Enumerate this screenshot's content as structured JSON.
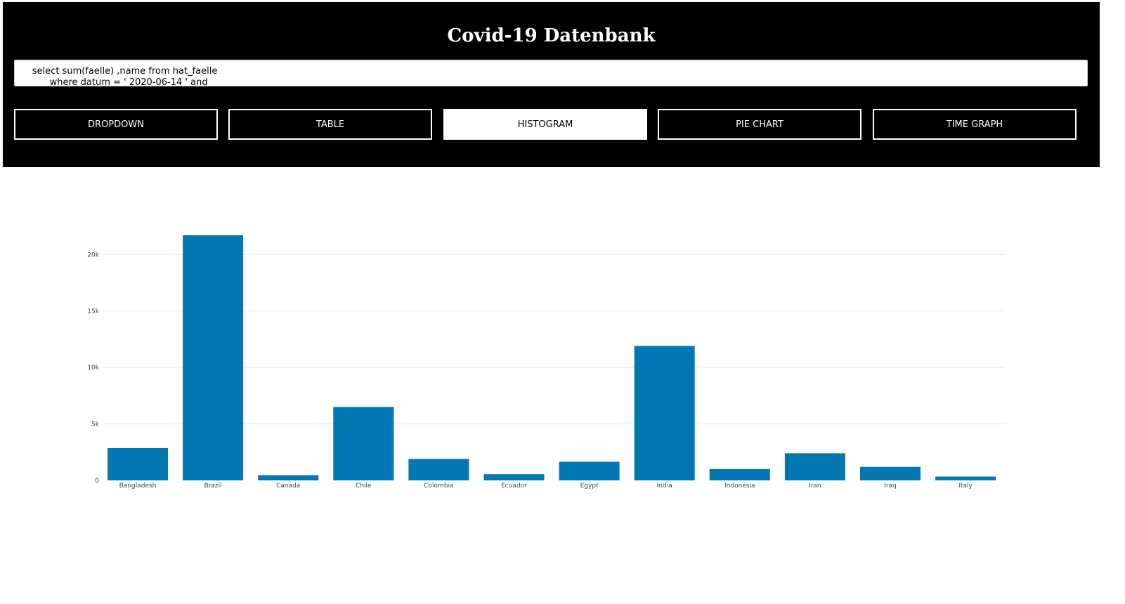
{
  "header": {
    "title": "Covid-19 Datenbank",
    "query": "      select sum(faelle) ,name from hat_faelle\n            where datum = ' 2020-06-14 ' and"
  },
  "tabs": [
    {
      "label": "DROPDOWN",
      "active": false
    },
    {
      "label": "TABLE",
      "active": false
    },
    {
      "label": "HISTOGRAM",
      "active": true
    },
    {
      "label": "PIE CHART",
      "active": false
    },
    {
      "label": "TIME GRAPH",
      "active": false
    }
  ],
  "chart_data": {
    "type": "bar",
    "categories": [
      "Bangladesh",
      "Brazil",
      "Canada",
      "Chile",
      "Colombia",
      "Ecuador",
      "Egypt",
      "India",
      "Indonesia",
      "Iran",
      "Iraq",
      "Italy"
    ],
    "values": [
      2860,
      21700,
      460,
      6500,
      1900,
      550,
      1650,
      11900,
      1000,
      2400,
      1200,
      340
    ],
    "ylim": [
      0,
      21700
    ],
    "yticks": [
      0,
      5000,
      10000,
      15000,
      20000
    ],
    "ytick_labels": [
      "0",
      "5k",
      "10k",
      "15k",
      "20k"
    ],
    "bar_color": "#0277b1",
    "grid": true
  }
}
